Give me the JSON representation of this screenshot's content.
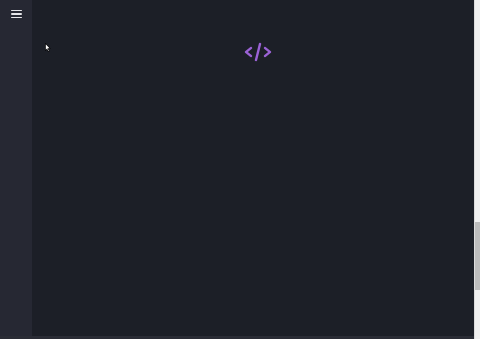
{
  "sidebar": {
    "menu_icon": "hamburger-menu-icon"
  },
  "main": {
    "logo_icon": "code-brackets-icon",
    "logo_color": "#9b62d6"
  },
  "colors": {
    "background": "#1c1f27",
    "sidebar": "#262833"
  }
}
